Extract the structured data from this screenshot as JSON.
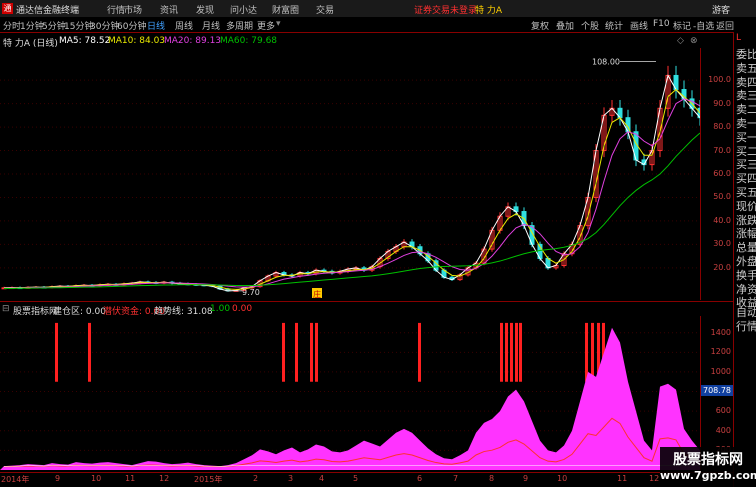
{
  "app": {
    "title": "通达信金融终端",
    "menus": [
      "行情",
      "市场",
      "资讯",
      "发现",
      "问小达",
      "财富圈",
      "交易"
    ],
    "notice": "证券交易未登录",
    "current_stock": "特 力A",
    "guest": "游客"
  },
  "periods": [
    "分时",
    "1分钟",
    "5分钟",
    "15分钟",
    "30分钟",
    "60分钟",
    "日线",
    "周线",
    "月线",
    "多周期",
    "更多"
  ],
  "active_period": "日线",
  "tools": [
    "复权",
    "叠加",
    "个股",
    "统计",
    "画线",
    "F10",
    "标记",
    "-自选",
    "返回"
  ],
  "chart_info": {
    "name": "特 力A (日线)",
    "ma5": "MA5: 78.52",
    "ma10": "MA10: 84.03",
    "ma20": "MA20: 89.13",
    "ma60": "MA60: 79.68"
  },
  "indicator_info": {
    "name": "股票指标网",
    "jc": "建仓区: 0.00",
    "mszj": "潜伏资金: 0.00",
    "qsx": "趋势线: 31.08",
    "v1": "1.00",
    "v2": "0.00"
  },
  "price_annotations": {
    "high": "108.00",
    "low": "9.70"
  },
  "vol_marker": "708.78",
  "badge": "庄",
  "right_panel": [
    "委比",
    "卖五",
    "卖四",
    "卖三",
    "卖二",
    "卖一",
    "买一",
    "买二",
    "买三",
    "买四",
    "买五",
    "现价",
    "涨跌",
    "涨幅",
    "总量",
    "外盘",
    "换手",
    "净资",
    "收益"
  ],
  "right_panel_bottom": [
    "自动",
    "行情"
  ],
  "watermark": {
    "cn": "股票指标网",
    "url": "www.7gpzb.com"
  },
  "colors": {
    "ma5": "#ffffff",
    "ma10": "#e8e800",
    "ma20": "#e040e0",
    "ma60": "#00c000",
    "axis": "#c84040",
    "bars": "#ff2020",
    "area": "#ff33ff"
  },
  "chart_data": [
    {
      "type": "line",
      "x_labels": [
        "2014年",
        "9",
        "10",
        "11",
        "12",
        "2015年",
        "2",
        "3",
        "4",
        "5",
        "6",
        "7",
        "8",
        "9",
        "10",
        "11",
        "12"
      ],
      "y_ticks": [
        20.0,
        30.0,
        40.0,
        50.0,
        60.0,
        70.0,
        80.0,
        90.0,
        100.0
      ],
      "ylim": [
        8,
        112
      ],
      "x": [
        0,
        8,
        16,
        24,
        32,
        40,
        48,
        56,
        64,
        72,
        80,
        88,
        96,
        104,
        112,
        120,
        128,
        136,
        144,
        152,
        160,
        168,
        176,
        184,
        192,
        200,
        208,
        216,
        224,
        232,
        240,
        248,
        256,
        264,
        272,
        280,
        288,
        296,
        304,
        312,
        320,
        328,
        336,
        344,
        352,
        360,
        368,
        376,
        384,
        392,
        400,
        408,
        416,
        424,
        432,
        440,
        448,
        456,
        464,
        472,
        480,
        488,
        496,
        504,
        512,
        520,
        528,
        536,
        544,
        552,
        560,
        568,
        576,
        584,
        592,
        600,
        608,
        616,
        624,
        632,
        640,
        648,
        656,
        664,
        672,
        680,
        688,
        696
      ],
      "series": [
        {
          "name": "MA5",
          "values": [
            11.5,
            11.6,
            11.5,
            11.7,
            11.8,
            11.7,
            12.0,
            12.2,
            12.1,
            12.4,
            12.6,
            12.5,
            12.8,
            13.0,
            12.9,
            13.2,
            13.5,
            14.0,
            13.8,
            13.6,
            13.9,
            13.5,
            13.2,
            13.0,
            12.8,
            12.6,
            12.2,
            11.0,
            10.2,
            10.4,
            11.5,
            12.0,
            14.5,
            16.5,
            18.0,
            17.0,
            16.5,
            18.0,
            17.5,
            19.0,
            18.5,
            17.8,
            18.5,
            19.5,
            20.0,
            19.0,
            20.5,
            24.0,
            27.0,
            29.0,
            31.0,
            29.0,
            26.0,
            23.0,
            19.0,
            16.0,
            15.0,
            17.0,
            20.0,
            22.0,
            28.0,
            36.0,
            42.0,
            46.0,
            44.0,
            38.0,
            30.0,
            24.0,
            20.0,
            21.0,
            26.0,
            30.0,
            38.0,
            50.0,
            70.0,
            85.0,
            88.0,
            84.0,
            78.0,
            66.0,
            64.0,
            70.0,
            88.0,
            102.0,
            96.0,
            92.0,
            88.0,
            84.0
          ]
        },
        {
          "name": "MA10",
          "values": [
            11.4,
            11.5,
            11.5,
            11.6,
            11.7,
            11.7,
            11.9,
            12.0,
            12.1,
            12.3,
            12.5,
            12.5,
            12.7,
            12.9,
            12.9,
            13.1,
            13.3,
            13.7,
            13.7,
            13.7,
            13.8,
            13.6,
            13.4,
            13.2,
            13.0,
            12.8,
            12.5,
            11.8,
            11.0,
            10.8,
            11.0,
            11.6,
            13.0,
            14.5,
            16.0,
            16.8,
            16.8,
            17.5,
            17.5,
            18.2,
            18.4,
            18.2,
            18.3,
            18.8,
            19.2,
            19.3,
            19.8,
            22.0,
            24.5,
            27.0,
            29.0,
            29.0,
            27.5,
            25.0,
            22.0,
            19.0,
            16.8,
            16.5,
            18.0,
            20.0,
            24.0,
            30.0,
            36.0,
            41.0,
            43.0,
            41.0,
            35.0,
            29.0,
            24.0,
            22.0,
            23.5,
            27.0,
            33.0,
            42.0,
            56.0,
            72.0,
            82.0,
            84.0,
            80.0,
            73.0,
            68.0,
            68.0,
            78.0,
            93.0,
            96.0,
            93.0,
            90.0,
            86.0
          ]
        },
        {
          "name": "MA20",
          "values": [
            11.3,
            11.4,
            11.4,
            11.5,
            11.6,
            11.6,
            11.7,
            11.8,
            11.9,
            12.0,
            12.2,
            12.3,
            12.4,
            12.6,
            12.7,
            12.8,
            13.0,
            13.2,
            13.4,
            13.5,
            13.6,
            13.6,
            13.5,
            13.4,
            13.3,
            13.1,
            12.9,
            12.6,
            12.2,
            11.9,
            11.8,
            11.9,
            12.4,
            13.2,
            14.2,
            15.2,
            15.8,
            16.4,
            16.8,
            17.3,
            17.7,
            17.9,
            18.1,
            18.4,
            18.7,
            19.0,
            19.3,
            20.5,
            22.0,
            23.6,
            25.3,
            26.5,
            26.8,
            26.0,
            24.5,
            22.5,
            20.5,
            19.3,
            19.0,
            19.8,
            21.8,
            25.0,
            29.0,
            33.5,
            37.0,
            38.5,
            37.5,
            34.5,
            30.5,
            27.0,
            25.5,
            26.0,
            29.0,
            35.0,
            45.0,
            57.0,
            68.0,
            75.0,
            78.0,
            77.0,
            74.0,
            72.0,
            75.0,
            83.0,
            90.0,
            92.0,
            91.0,
            89.0
          ]
        },
        {
          "name": "MA60",
          "values": [
            11.2,
            11.2,
            11.3,
            11.3,
            11.4,
            11.4,
            11.5,
            11.5,
            11.6,
            11.7,
            11.8,
            11.8,
            11.9,
            12.0,
            12.1,
            12.2,
            12.3,
            12.4,
            12.5,
            12.6,
            12.7,
            12.7,
            12.8,
            12.8,
            12.8,
            12.8,
            12.8,
            12.7,
            12.6,
            12.5,
            12.5,
            12.5,
            12.6,
            12.8,
            13.0,
            13.3,
            13.6,
            13.9,
            14.2,
            14.5,
            14.8,
            15.1,
            15.4,
            15.7,
            16.0,
            16.3,
            16.6,
            17.0,
            17.5,
            18.0,
            18.6,
            19.2,
            19.7,
            20.1,
            20.4,
            20.6,
            20.7,
            20.8,
            20.9,
            21.1,
            21.5,
            22.1,
            22.9,
            23.9,
            25.0,
            26.0,
            26.8,
            27.4,
            27.8,
            28.2,
            28.8,
            29.6,
            30.8,
            32.5,
            35.0,
            38.5,
            42.5,
            46.5,
            50.0,
            53.0,
            55.5,
            57.5,
            60.0,
            63.5,
            67.5,
            71.0,
            74.5,
            77.5
          ]
        }
      ]
    },
    {
      "type": "area",
      "y_ticks": [
        200,
        400,
        600,
        800,
        1000,
        1200,
        1400
      ],
      "ylim": [
        0,
        1550
      ],
      "x": [
        0,
        8,
        16,
        24,
        32,
        40,
        48,
        56,
        64,
        72,
        80,
        88,
        96,
        104,
        112,
        120,
        128,
        136,
        144,
        152,
        160,
        168,
        176,
        184,
        192,
        200,
        208,
        216,
        224,
        232,
        240,
        248,
        256,
        264,
        272,
        280,
        288,
        296,
        304,
        312,
        320,
        328,
        336,
        344,
        352,
        360,
        368,
        376,
        384,
        392,
        400,
        408,
        416,
        424,
        432,
        440,
        448,
        456,
        464,
        472,
        480,
        488,
        496,
        504,
        512,
        520,
        528,
        536,
        544,
        552,
        560,
        568,
        576,
        584,
        592,
        600,
        608,
        616,
        624,
        632,
        640,
        648,
        656,
        664,
        672,
        680,
        688,
        696
      ],
      "series": [
        {
          "name": "area",
          "values": [
            40,
            45,
            50,
            60,
            55,
            50,
            70,
            60,
            55,
            80,
            70,
            65,
            75,
            80,
            70,
            60,
            50,
            70,
            90,
            85,
            70,
            60,
            65,
            75,
            60,
            50,
            45,
            40,
            50,
            70,
            110,
            150,
            210,
            190,
            160,
            200,
            230,
            180,
            210,
            260,
            240,
            190,
            180,
            200,
            250,
            300,
            270,
            240,
            310,
            380,
            420,
            380,
            300,
            220,
            160,
            120,
            110,
            150,
            200,
            380,
            480,
            520,
            600,
            750,
            820,
            700,
            500,
            300,
            200,
            180,
            250,
            400,
            700,
            1000,
            950,
            1200,
            1450,
            1300,
            900,
            600,
            300,
            200,
            850,
            880,
            820,
            420,
            300,
            200
          ]
        }
      ],
      "bars_x": [
        55,
        88,
        282,
        295,
        310,
        315,
        418,
        500,
        505,
        510,
        515,
        519,
        585,
        591,
        597,
        602
      ],
      "bars_value": [
        [
          900,
          1500
        ],
        [
          900,
          1500
        ],
        [
          900,
          1500
        ],
        [
          900,
          1500
        ],
        [
          900,
          1500
        ],
        [
          900,
          1500
        ],
        [
          900,
          1500
        ],
        [
          900,
          1500
        ],
        [
          900,
          1500
        ],
        [
          900,
          1500
        ],
        [
          900,
          1500
        ],
        [
          900,
          1500
        ],
        [
          900,
          1500
        ],
        [
          900,
          1500
        ],
        [
          900,
          1500
        ],
        [
          900,
          1500
        ]
      ]
    }
  ]
}
